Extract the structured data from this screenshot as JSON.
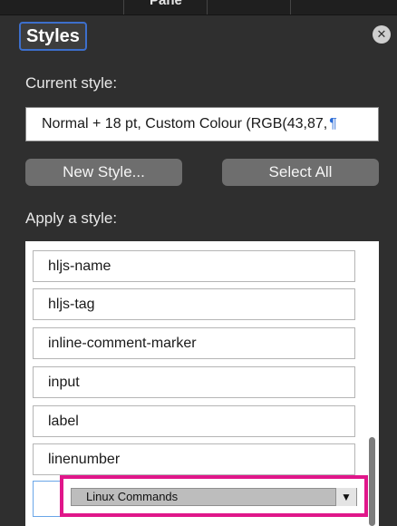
{
  "top_tab": {
    "label": "Pane"
  },
  "header": {
    "title": "Styles",
    "close_icon": "close-icon"
  },
  "current_style": {
    "label": "Current style:",
    "value": "Normal + 18 pt, Custom Colour (RGB(43,87,",
    "pilcrow": "¶"
  },
  "buttons": {
    "new_style": "New Style...",
    "select_all": "Select All"
  },
  "apply_style": {
    "label": "Apply a style:"
  },
  "style_list": {
    "items": [
      {
        "label": "hljs-name"
      },
      {
        "label": "hljs-tag"
      },
      {
        "label": "inline-comment-marker"
      },
      {
        "label": "input"
      },
      {
        "label": "label"
      },
      {
        "label": "linenumber"
      }
    ],
    "dropdown": {
      "selected": "Linux Commands",
      "arrow": "▼"
    }
  },
  "colors": {
    "pane_bg": "#2f2f2f",
    "button_bg": "#6e6e6e",
    "title_border": "#3d6fcc",
    "highlight": "#e0168a",
    "pilcrow": "#2b6cd6"
  }
}
